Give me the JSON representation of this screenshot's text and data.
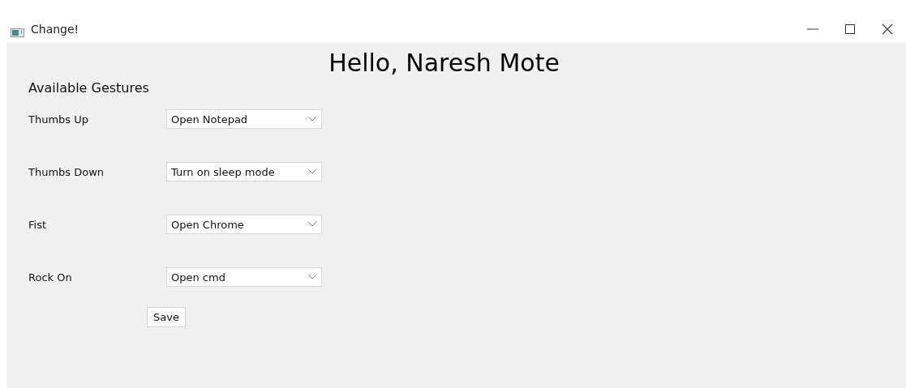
{
  "window": {
    "title": "Change!"
  },
  "heading": "Hello, Naresh Mote",
  "section_title": "Available Gestures",
  "gestures": [
    {
      "label": "Thumbs Up",
      "action": "Open Notepad"
    },
    {
      "label": "Thumbs Down",
      "action": "Turn on sleep mode"
    },
    {
      "label": "Fist",
      "action": "Open Chrome"
    },
    {
      "label": "Rock On",
      "action": "Open cmd"
    }
  ],
  "buttons": [
    "Save"
  ]
}
